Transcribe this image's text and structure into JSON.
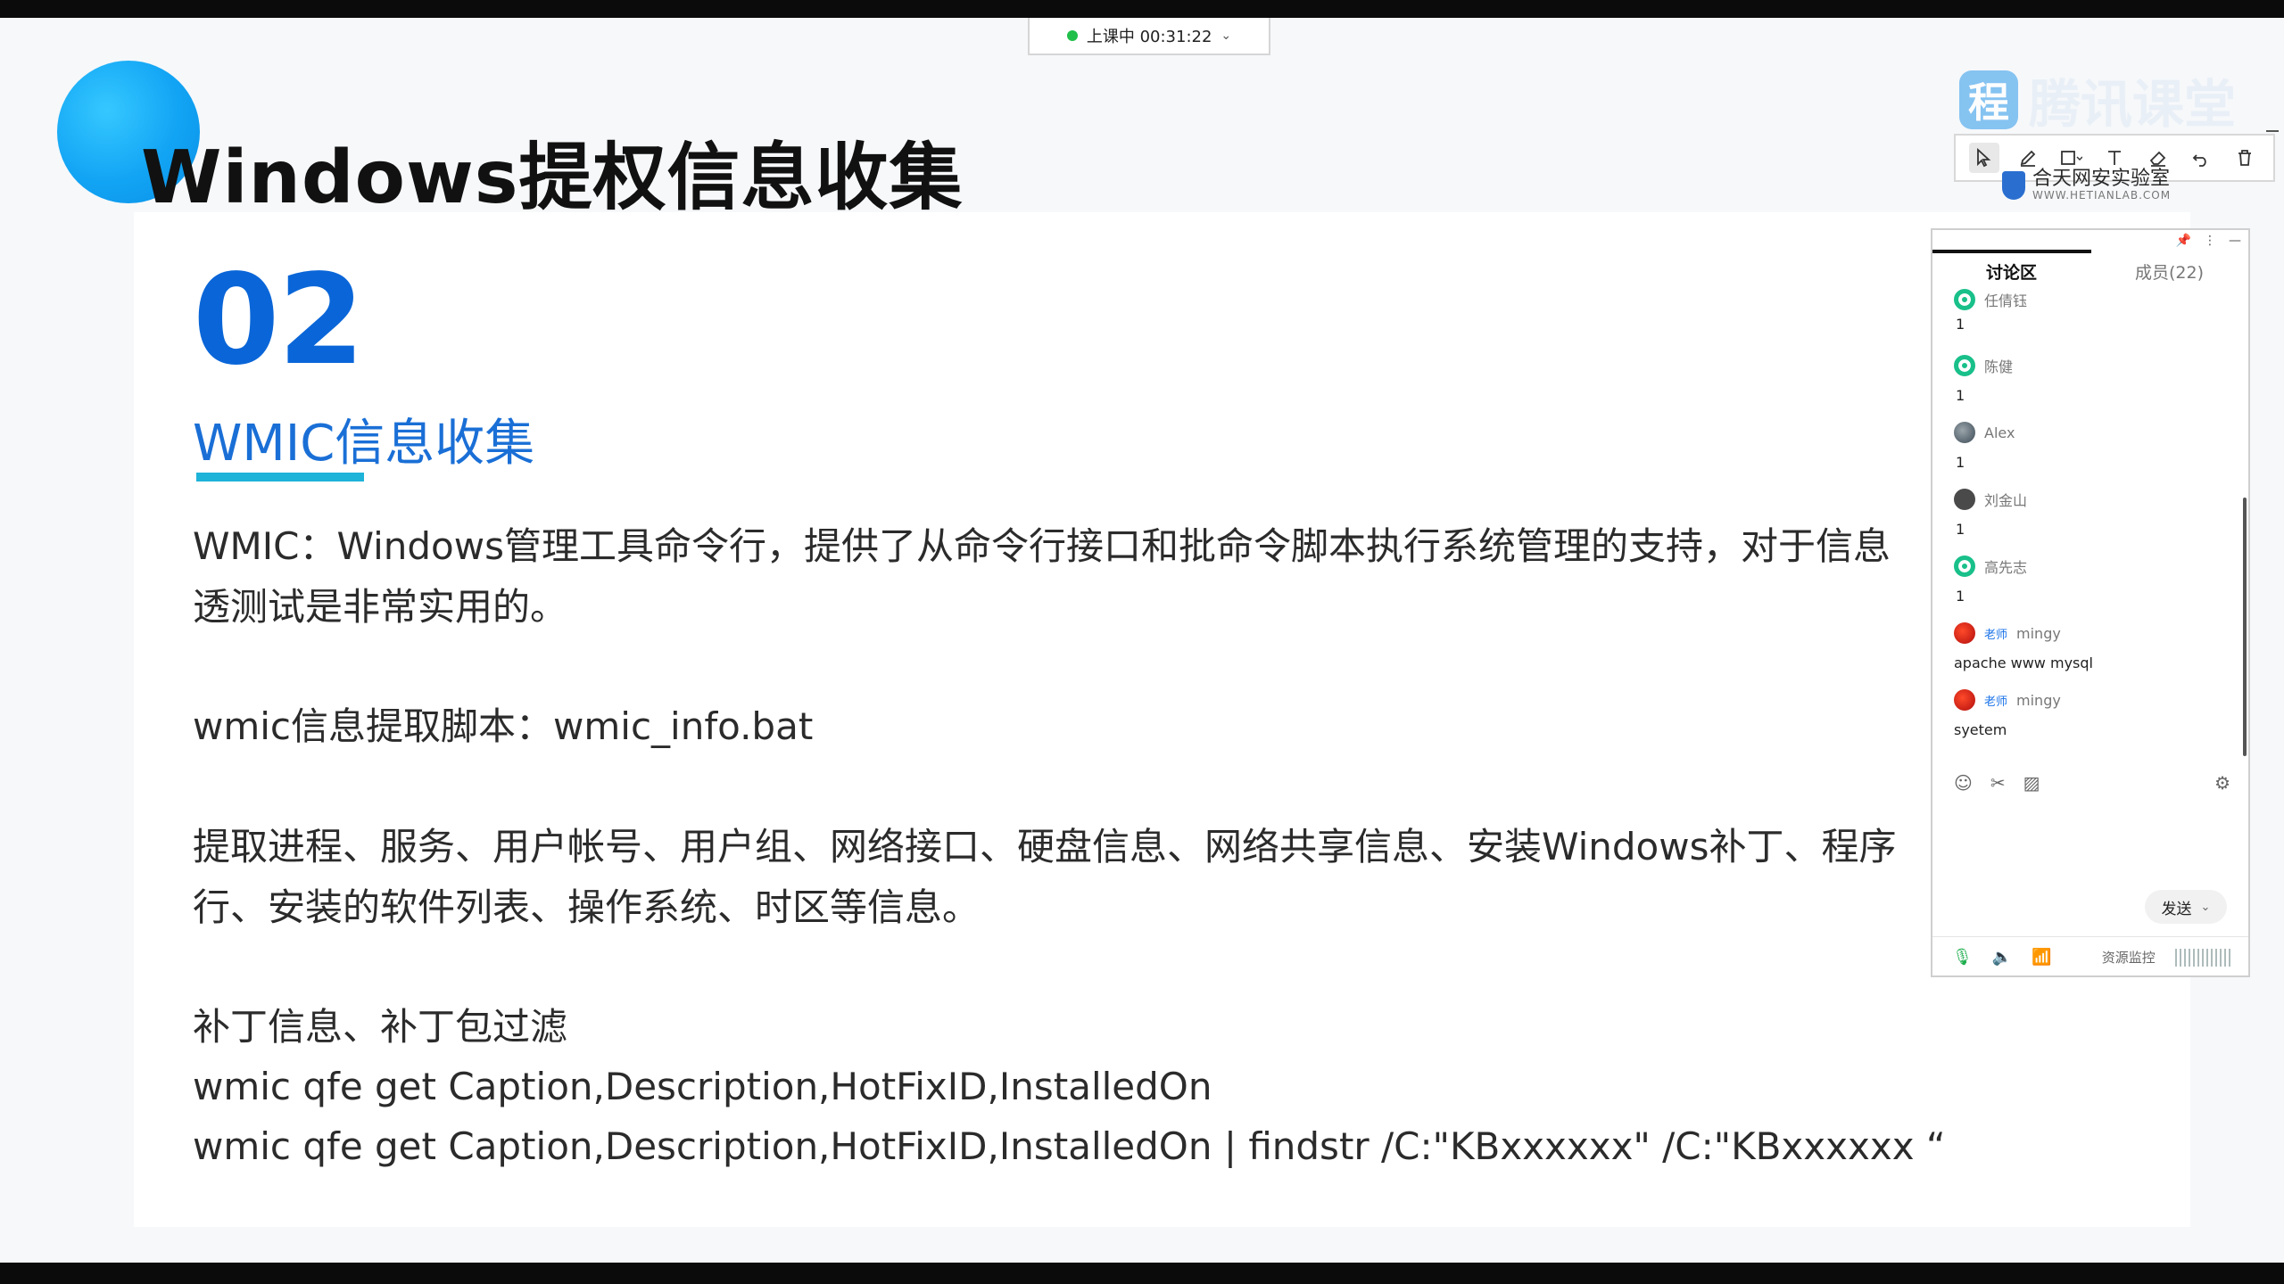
{
  "status": {
    "text": "上课中 00:31:22"
  },
  "watermark": {
    "badge": "程",
    "brand": "腾讯课堂",
    "lab_name": "合天网安实验室",
    "lab_url": "WWW.HETIANLAB.COM"
  },
  "slide": {
    "title": "Windows提权信息收集",
    "number": "02",
    "subtitle": "WMIC信息收集",
    "lines": [
      "WMIC：Windows管理工具命令行，提供了从命令行接口和批命令脚本执行系统管理的支持，对于信息",
      "透测试是非常实用的。",
      "wmic信息提取脚本：wmic_info.bat",
      "提取进程、服务、用户帐号、用户组、网络接口、硬盘信息、网络共享信息、安装Windows补丁、程序",
      "行、安装的软件列表、操作系统、时区等信息。",
      "补丁信息、补丁包过滤",
      "wmic qfe get Caption,Description,HotFixID,InstalledOn",
      "wmic qfe get Caption,Description,HotFixID,InstalledOn | findstr /C:\"KBxxxxxx\" /C:\"KBxxxxxx “"
    ]
  },
  "toolbar": {
    "icons": [
      "pointer-icon",
      "pen-icon",
      "rectangle-icon",
      "text-icon",
      "eraser-icon",
      "undo-icon",
      "trash-icon"
    ]
  },
  "chat": {
    "tabs": [
      "讨论区",
      "成员(22)"
    ],
    "messages": [
      {
        "name": "任倩钰",
        "role": "",
        "text": "1",
        "avatar": "green"
      },
      {
        "name": "陈健",
        "role": "",
        "text": "1",
        "avatar": "green"
      },
      {
        "name": "Alex",
        "role": "",
        "text": "1",
        "avatar": "photo"
      },
      {
        "name": "刘金山",
        "role": "",
        "text": "1",
        "avatar": "dark"
      },
      {
        "name": "高先志",
        "role": "",
        "text": "1",
        "avatar": "green"
      },
      {
        "name": "mingy",
        "role": "老师",
        "text": "apache www mysql",
        "avatar": "red"
      },
      {
        "name": "mingy",
        "role": "老师",
        "text": "syetem",
        "avatar": "red"
      }
    ],
    "send_label": "发送",
    "resource_label": "资源监控"
  }
}
